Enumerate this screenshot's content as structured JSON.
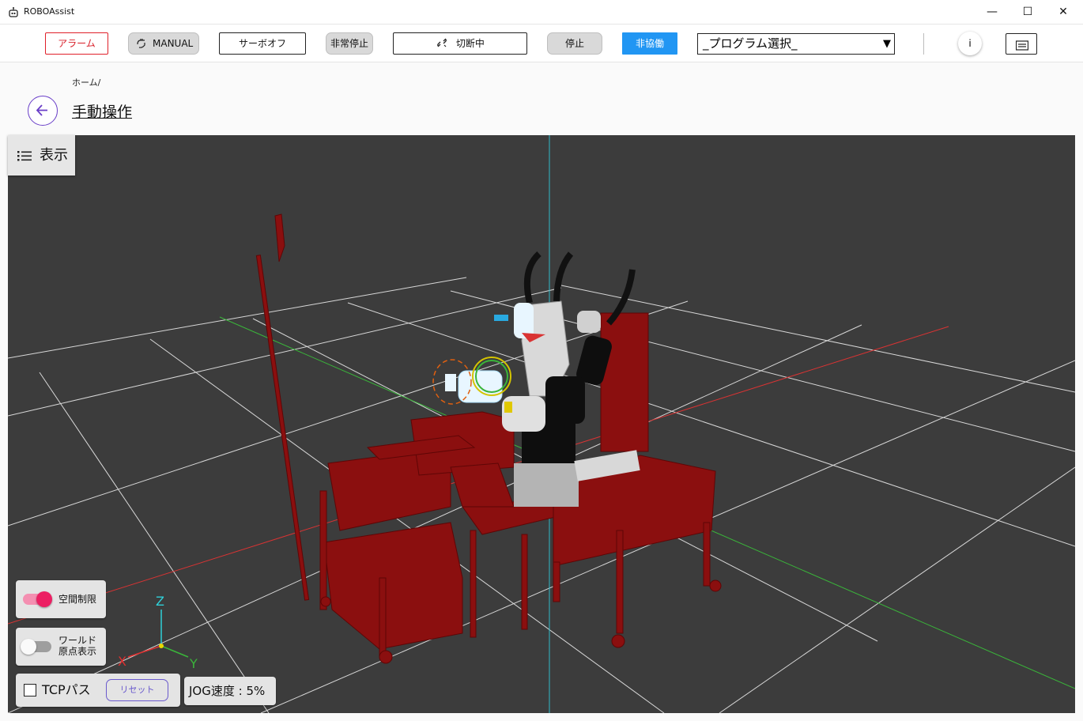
{
  "window": {
    "title": "ROBOAssist",
    "minimize_glyph": "—",
    "maximize_glyph": "☐",
    "close_glyph": "✕"
  },
  "toolbar": {
    "alarm_label": "アラーム",
    "manual_label": "MANUAL",
    "servo_off_label": "サーボオフ",
    "emergency_stop_label": "非常停止",
    "disconnected_label": "切断中",
    "stop_label": "停止",
    "non_collab_label": "非協働",
    "program_select": "_プログラム選択_",
    "info_label": "i"
  },
  "page": {
    "breadcrumb": "ホーム/",
    "title": "手動操作"
  },
  "viewport": {
    "show_button_label": "表示",
    "space_limit_label": "空間制限",
    "space_limit_on": true,
    "world_origin_label_1": "ワールド",
    "world_origin_label_2": "原点表示",
    "world_origin_on": false,
    "tcp_path_label": "TCPパス",
    "tcp_path_checked": false,
    "reset_label": "リセット",
    "jog_speed_label": "JOG速度 : 5%",
    "axis_x": "X",
    "axis_y": "Y",
    "axis_z": "Z"
  },
  "colors": {
    "alarm_red": "#d81e28",
    "accent_blue": "#2196f3",
    "accent_purple": "#6a3fc8",
    "toggle_pink": "#ec1f63",
    "scene_background": "#3c3c3c",
    "equipment_red": "#8b0f0f"
  },
  "icons": {
    "app": "robot-icon",
    "manual": "hand-icon",
    "disconnected": "link-broken-icon",
    "back": "arrow-left-icon",
    "show": "list-icon",
    "keyboard": "keyboard-icon"
  }
}
